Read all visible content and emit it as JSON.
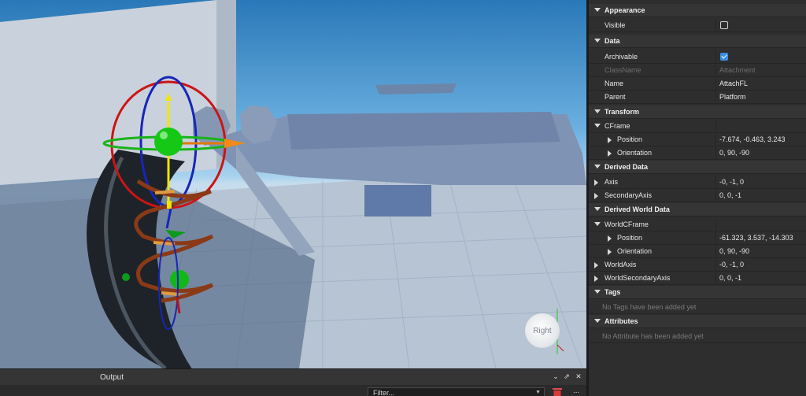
{
  "viewport": {
    "viewcube_label": "Right"
  },
  "output": {
    "title": "Output",
    "filter_placeholder": "Filter...",
    "more_label": "..."
  },
  "properties": {
    "appearance": {
      "label": "Appearance",
      "visible_label": "Visible",
      "visible": false
    },
    "data": {
      "label": "Data",
      "archivable_label": "Archivable",
      "archivable": true,
      "classname_label": "ClassName",
      "classname_value": "Attachment",
      "name_label": "Name",
      "name_value": "AttachFL",
      "parent_label": "Parent",
      "parent_value": "Platform"
    },
    "transform": {
      "label": "Transform",
      "cframe_label": "CFrame",
      "position_label": "Position",
      "position_value": "-7.674, -0.463, 3.243",
      "orientation_label": "Orientation",
      "orientation_value": "0, 90, -90"
    },
    "derived": {
      "label": "Derived Data",
      "axis_label": "Axis",
      "axis_value": "-0, -1, 0",
      "secondary_label": "SecondaryAxis",
      "secondary_value": "0, 0, -1"
    },
    "world": {
      "label": "Derived World Data",
      "cframe_label": "WorldCFrame",
      "position_label": "Position",
      "position_value": "-61.323, 3.537, -14.303",
      "orientation_label": "Orientation",
      "orientation_value": "0, 90, -90",
      "axis_label": "WorldAxis",
      "axis_value": "-0, -1, 0",
      "secondary_label": "WorldSecondaryAxis",
      "secondary_value": "0, 0, -1"
    },
    "tags": {
      "label": "Tags",
      "empty": "No Tags have been added yet"
    },
    "attributes": {
      "label": "Attributes",
      "empty": "No Attribute has been added yet"
    }
  },
  "colors": {
    "accent": "#3b8ee0",
    "panel": "#2e2e2e",
    "category_bg": "#353535"
  }
}
